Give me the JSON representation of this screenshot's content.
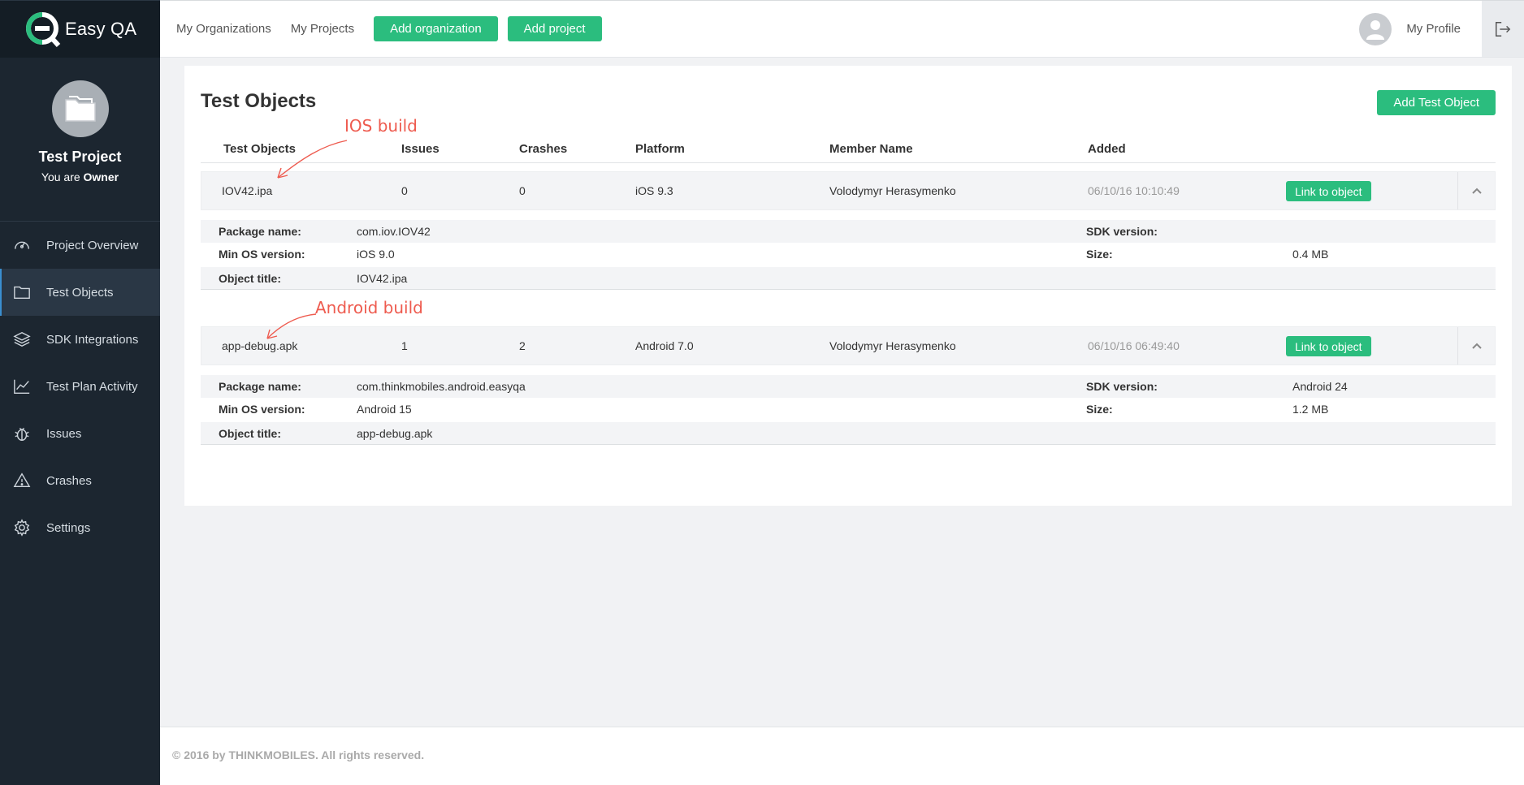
{
  "app": {
    "name": "Easy QA",
    "brand_color": "#2bbd7e"
  },
  "sidebar": {
    "project_name": "Test Project",
    "role_prefix": "You are",
    "role": "Owner",
    "items": [
      {
        "label": "Project Overview",
        "icon": "gauge-icon"
      },
      {
        "label": "Test Objects",
        "icon": "folder-icon",
        "active": true
      },
      {
        "label": "SDK Integrations",
        "icon": "layers-icon"
      },
      {
        "label": "Test Plan Activity",
        "icon": "chart-line-icon"
      },
      {
        "label": "Issues",
        "icon": "bug-icon"
      },
      {
        "label": "Crashes",
        "icon": "warning-icon"
      },
      {
        "label": "Settings",
        "icon": "gear-icon"
      }
    ]
  },
  "topbar": {
    "my_organizations": "My Organizations",
    "my_projects": "My Projects",
    "add_organization": "Add organization",
    "add_project": "Add project",
    "my_profile": "My Profile"
  },
  "main": {
    "title": "Test Objects",
    "add_button": "Add Test Object",
    "columns": [
      "Test Objects",
      "Issues",
      "Crashes",
      "Platform",
      "Member Name",
      "Added"
    ],
    "detail_labels": {
      "package": "Package name:",
      "min_os": "Min OS version:",
      "object_title": "Object title:",
      "sdk": "SDK version:",
      "size": "Size:"
    },
    "link_label": "Link to object",
    "objects": [
      {
        "name": "IOV42.ipa",
        "issues": "0",
        "crashes": "0",
        "platform": "iOS 9.3",
        "member": "Volodymyr Herasymenko",
        "added": "06/10/16 10:10:49",
        "package": "com.iov.IOV42",
        "min_os": "iOS 9.0",
        "object_title": "IOV42.ipa",
        "sdk": "",
        "size": "0.4 MB"
      },
      {
        "name": "app-debug.apk",
        "issues": "1",
        "crashes": "2",
        "platform": "Android 7.0",
        "member": "Volodymyr Herasymenko",
        "added": "06/10/16 06:49:40",
        "package": "com.thinkmobiles.android.easyqa",
        "min_os": "Android 15",
        "object_title": "app-debug.apk",
        "sdk": "Android 24",
        "size": "1.2 MB"
      }
    ]
  },
  "annotations": {
    "ios": "IOS build",
    "android": "Android build",
    "color": "#ee5b4f"
  },
  "footer": {
    "text": "© 2016 by THINKMOBILES. All rights reserved."
  }
}
